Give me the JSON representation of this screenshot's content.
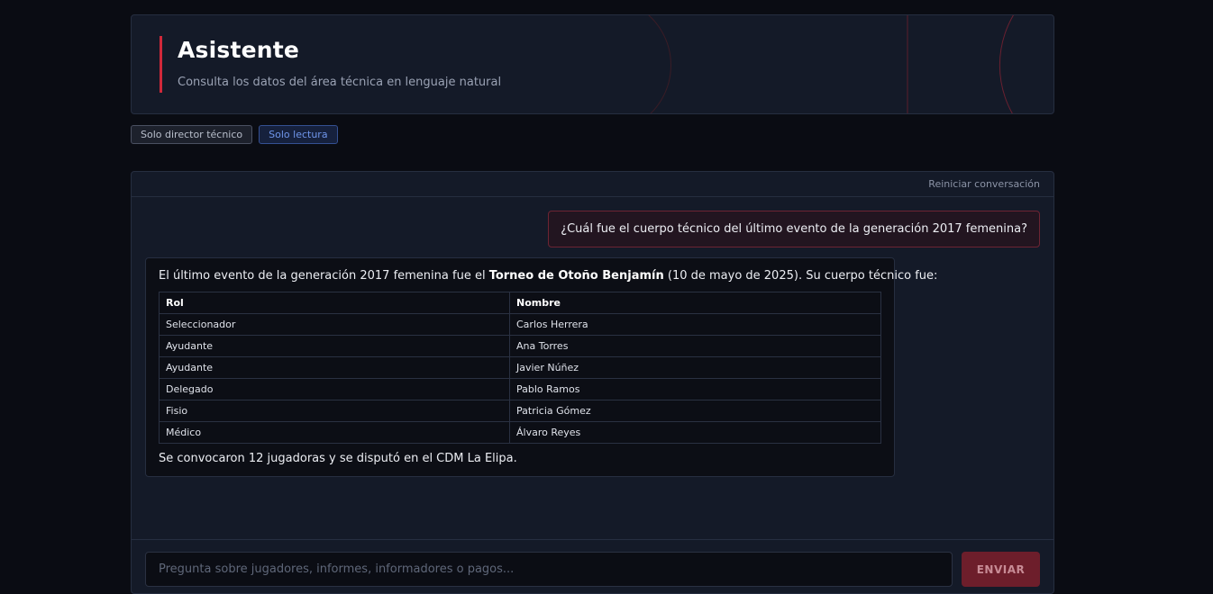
{
  "header": {
    "title": "Asistente",
    "subtitle": "Consulta los datos del área técnica en lenguaje natural"
  },
  "badges": {
    "role": "Solo director técnico",
    "mode": "Solo lectura"
  },
  "chat": {
    "reset_label": "Reiniciar conversación",
    "user_message": "¿Cuál fue el cuerpo técnico del último evento de la generación 2017 femenina?",
    "bot": {
      "intro_before": "El último evento de la generación 2017 femenina fue el ",
      "intro_event": "Torneo de Otoño Benjamín",
      "intro_after": " (10 de mayo de 2025). Su cuerpo técnico fue:",
      "table": {
        "headers": [
          "Rol",
          "Nombre"
        ],
        "rows": [
          [
            "Seleccionador",
            "Carlos Herrera"
          ],
          [
            "Ayudante",
            "Ana Torres"
          ],
          [
            "Ayudante",
            "Javier Núñez"
          ],
          [
            "Delegado",
            "Pablo Ramos"
          ],
          [
            "Fisio",
            "Patricia Gómez"
          ],
          [
            "Médico",
            "Álvaro Reyes"
          ]
        ]
      },
      "outro": "Se convocaron 12 jugadoras y se disputó en el CDM La Elipa."
    }
  },
  "composer": {
    "value": "",
    "placeholder": "Pregunta sobre jugadores, informes, informadores o pagos...",
    "send_label": "ENVIAR"
  },
  "colors": {
    "accent": "#d0283a",
    "background": "#0a0c13",
    "panel": "#141a28",
    "send_button": "#6d1e2b"
  }
}
